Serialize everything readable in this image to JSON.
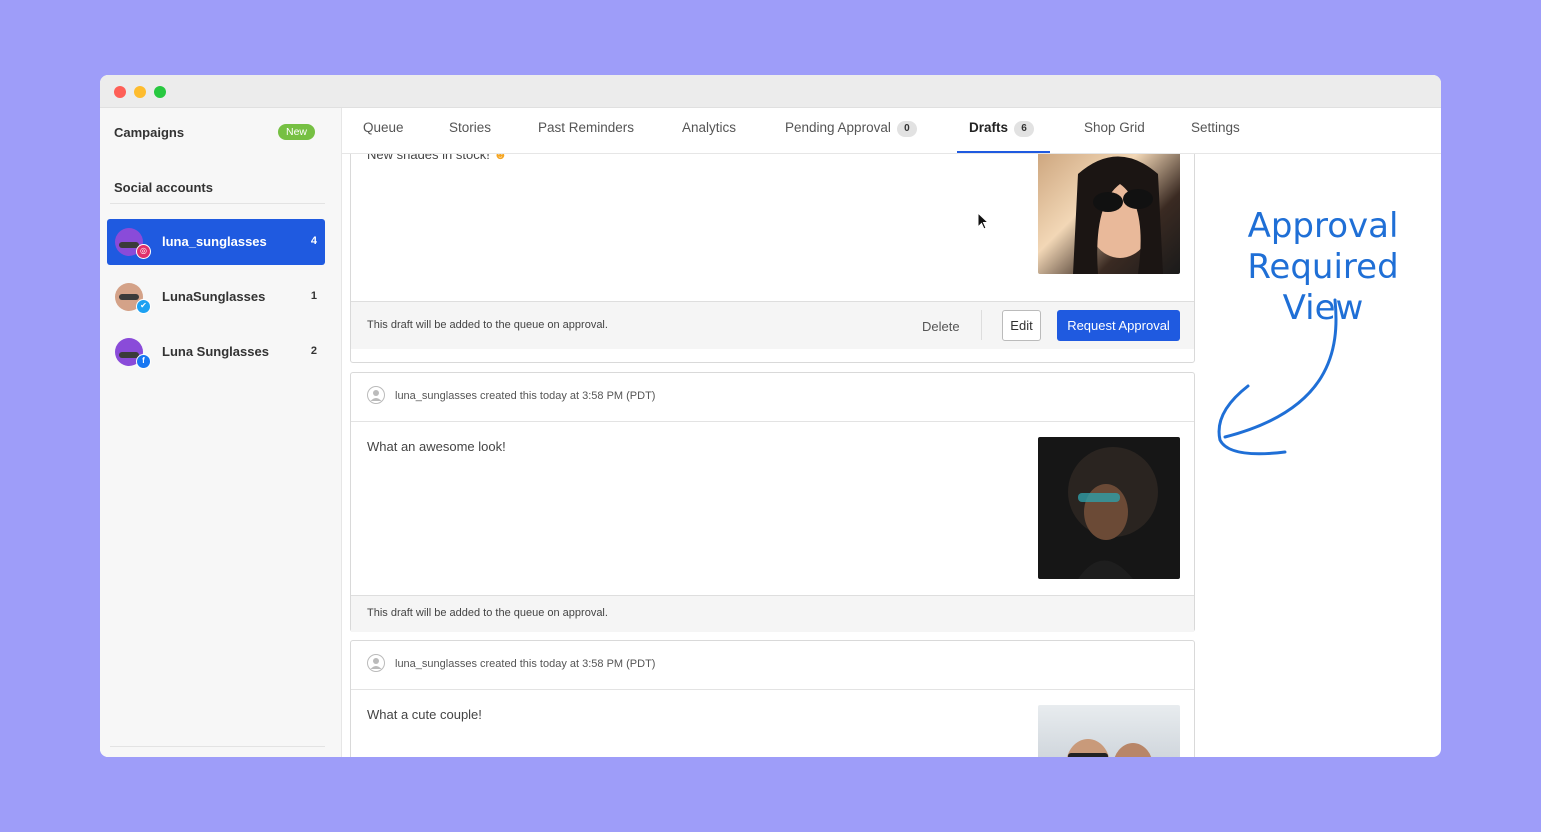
{
  "sidebar": {
    "campaigns_label": "Campaigns",
    "new_badge": "New",
    "social_label": "Social accounts",
    "accounts": [
      {
        "name": "luna_sunglasses",
        "count": "4",
        "network": "instagram",
        "active": true
      },
      {
        "name": "LunaSunglasses",
        "count": "1",
        "network": "twitter",
        "active": false
      },
      {
        "name": "Luna Sunglasses",
        "count": "2",
        "network": "facebook",
        "active": false
      }
    ]
  },
  "tabs": [
    {
      "label": "Queue"
    },
    {
      "label": "Stories"
    },
    {
      "label": "Past Reminders"
    },
    {
      "label": "Analytics"
    },
    {
      "label": "Pending Approval",
      "count": "0"
    },
    {
      "label": "Drafts",
      "count": "6",
      "active": true
    },
    {
      "label": "Shop Grid"
    },
    {
      "label": "Settings"
    }
  ],
  "drafts": [
    {
      "caption": "New shades in stock!",
      "footer": "This draft will be added to the queue on approval.",
      "actions": {
        "delete": "Delete",
        "edit": "Edit",
        "request": "Request Approval"
      }
    },
    {
      "meta": "luna_sunglasses created this today at 3:58 PM (PDT)",
      "caption": "What an awesome look!",
      "footer": "This draft will be added to the queue on approval."
    },
    {
      "meta": "luna_sunglasses created this today at 3:58 PM (PDT)",
      "caption": "What a cute couple!"
    }
  ],
  "annotation": {
    "line1": "Approval",
    "line2": "Required View",
    "color": "#1f6fd6"
  },
  "colors": {
    "background": "#9e9df9",
    "accent": "#1f5ae0",
    "new_badge": "#76c043"
  }
}
